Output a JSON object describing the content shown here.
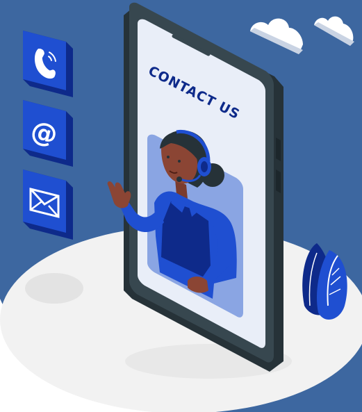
{
  "illustration": {
    "phone_heading": "CONTACT US",
    "contact_icons": [
      "phone-icon",
      "at-sign-icon",
      "envelope-icon"
    ]
  },
  "colors": {
    "background": "#3d67a0",
    "accent_blue": "#1f4fd1",
    "dark_blue": "#0e2a8a",
    "phone_frame": "#37474f",
    "screen": "#e9eef8",
    "platform": "#f2f2f2"
  }
}
